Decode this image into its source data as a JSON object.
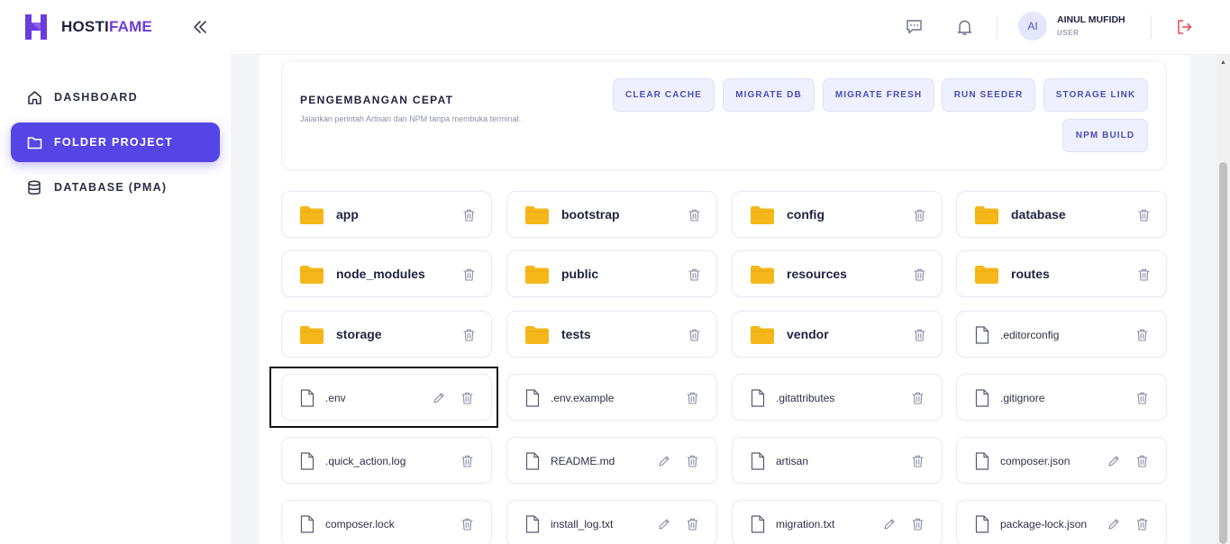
{
  "brand": {
    "name_main": "HOSTI",
    "name_accent": "FAME",
    "accent_color": "#6c3bdc"
  },
  "sidebar": {
    "items": [
      {
        "label": "DASHBOARD",
        "icon": "home-icon"
      },
      {
        "label": "FOLDER PROJECT",
        "icon": "folder-icon",
        "active": true
      },
      {
        "label": "DATABASE (PMA)",
        "icon": "database-icon"
      }
    ],
    "active_color": "#5545e6"
  },
  "header": {
    "user_initials": "AI",
    "user_name": "AINUL MUFIDH",
    "user_role": "USER",
    "icons": [
      "chat-icon",
      "bell-icon",
      "logout-icon"
    ]
  },
  "quick_actions": {
    "title": "PENGEMBANGAN CEPAT",
    "description": "Jalankan perintah Artisan dan NPM tanpa membuka terminal.",
    "buttons": [
      "CLEAR CACHE",
      "MIGRATE DB",
      "MIGRATE FRESH",
      "RUN SEEDER",
      "STORAGE LINK",
      "NPM BUILD"
    ]
  },
  "folders": [
    "app",
    "bootstrap",
    "config",
    "database",
    "node_modules",
    "public",
    "resources",
    "routes",
    "storage",
    "tests",
    "vendor"
  ],
  "files": [
    {
      "name": ".editorconfig",
      "editable": false
    },
    {
      "name": ".env",
      "editable": true
    },
    {
      "name": ".env.example",
      "editable": false
    },
    {
      "name": ".gitattributes",
      "editable": false
    },
    {
      "name": ".gitignore",
      "editable": false
    },
    {
      "name": ".quick_action.log",
      "editable": false
    },
    {
      "name": "README.md",
      "editable": true
    },
    {
      "name": "artisan",
      "editable": false
    },
    {
      "name": "composer.json",
      "editable": true
    },
    {
      "name": "composer.lock",
      "editable": false
    },
    {
      "name": "install_log.txt",
      "editable": true
    },
    {
      "name": "migration.txt",
      "editable": true
    },
    {
      "name": "package-lock.json",
      "editable": true
    }
  ],
  "colors": {
    "folder": "#f5b719",
    "logout": "#e5484d"
  }
}
